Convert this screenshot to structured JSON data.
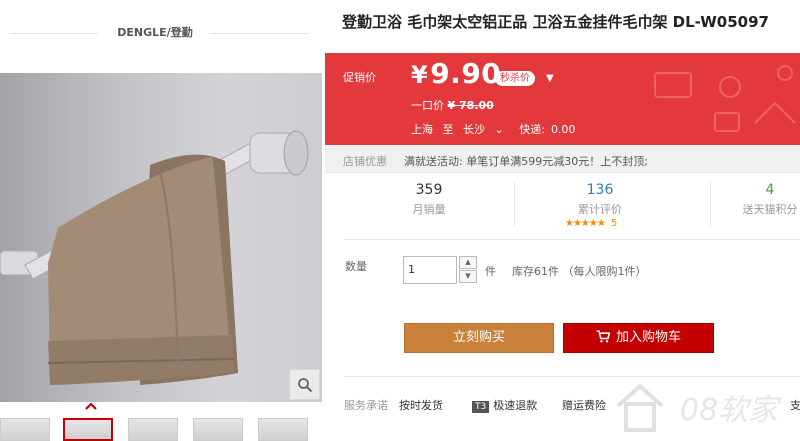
{
  "brand": {
    "label": "DENGLE/登勤"
  },
  "product": {
    "title": "登勤卫浴 毛巾架太空铝正品 卫浴五金挂件毛巾架 DL-W05097"
  },
  "price": {
    "label": "促销价",
    "currency": "¥",
    "value": "9.90",
    "badge": "秒杀价",
    "original_label": "一口价",
    "original_currency": "¥",
    "original_value": "78.00"
  },
  "shipping": {
    "from": "上海",
    "to_word": "至",
    "to": "长沙",
    "fee_label": "快递:",
    "fee": "0.00"
  },
  "promotion": {
    "label": "店铺优惠",
    "text": "满就送活动: 单笔订单满599元减30元！上不封顶;"
  },
  "stats": {
    "monthly_sales": {
      "value": "359",
      "label": "月销量"
    },
    "reviews": {
      "value": "136",
      "label": "累计评价",
      "stars": "★★★★★",
      "rating_count": "5"
    },
    "points": {
      "value": "4",
      "label": "送天猫积分"
    }
  },
  "quantity": {
    "label": "数量",
    "value": "1",
    "unit": "件",
    "stock": "库存61件 （每人限购1件）"
  },
  "buttons": {
    "buy_now": "立刻购买",
    "add_to_cart": "加入购物车"
  },
  "services": {
    "label": "服务承诺",
    "items": [
      "按时发货",
      "极速退款",
      "赠运费险",
      "支"
    ],
    "t3_badge": "T3"
  },
  "watermark": {
    "text": "08软家"
  },
  "colors": {
    "price_bg": "#e4393c",
    "buy_button": "#c9813c",
    "cart_button": "#c40000",
    "stat_sales": "#333333",
    "stat_reviews": "#2f7db6",
    "stat_points": "#5a9a2c",
    "stars": "#ff8800"
  }
}
